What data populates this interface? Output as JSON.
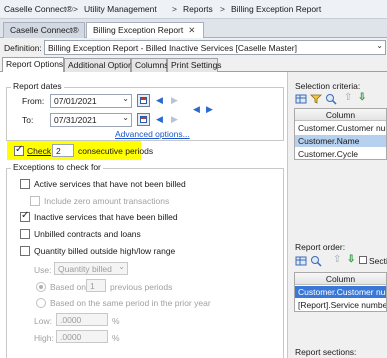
{
  "breadcrumb": {
    "items": [
      "Caselle Connect®",
      "Utility Management",
      "Reports",
      "Billing Exception Report"
    ],
    "separator": ">"
  },
  "doc_tabs": [
    {
      "label": "Caselle Connect®"
    },
    {
      "label": "Billing Exception Report",
      "close": "✕"
    }
  ],
  "definition": {
    "label": "Definition:",
    "value": "Billing Exception Report - Billed Inactive Services [Caselle Master]"
  },
  "option_tabs": [
    "Report Options",
    "Additional Options",
    "Columns",
    "Print Settings"
  ],
  "report_dates": {
    "title": "Report dates",
    "from_label": "From:",
    "from_value": "07/01/2021",
    "to_label": "To:",
    "to_value": "07/31/2021",
    "advanced_link": "Advanced options..."
  },
  "check_row": {
    "checkbox_label": "Check",
    "periods_value": "2",
    "suffix": "consecutive periods",
    "highlight_color": "#ffff00"
  },
  "exceptions": {
    "title": "Exceptions to check for",
    "active_not_billed": "Active services that have not been billed",
    "include_zero": "Include zero amount transactions",
    "inactive_billed": "Inactive services that have been billed",
    "unbilled_contracts": "Unbilled contracts and loans",
    "quantity_outside": "Quantity billed outside high/low range",
    "use_label": "Use:",
    "use_value": "Quantity billed",
    "based_on_label": "Based on",
    "based_on_value": "1",
    "previous_periods": "previous periods",
    "same_period": "Based on the same period in the prior year",
    "low_label": "Low:",
    "low_value": ".0000",
    "high_label": "High:",
    "high_value": ".0000",
    "percent": "%"
  },
  "selection_criteria": {
    "title": "Selection criteria:",
    "column_header": "Column",
    "rows": [
      "Customer.Customer number",
      "Customer.Name",
      "Customer.Cycle"
    ]
  },
  "report_order": {
    "title": "Report order:",
    "section_label": "Secti",
    "column_header": "Column",
    "rows": [
      "Customer.Customer number",
      "[Report].Service number"
    ]
  },
  "report_sections": {
    "title": "Report sections:"
  }
}
